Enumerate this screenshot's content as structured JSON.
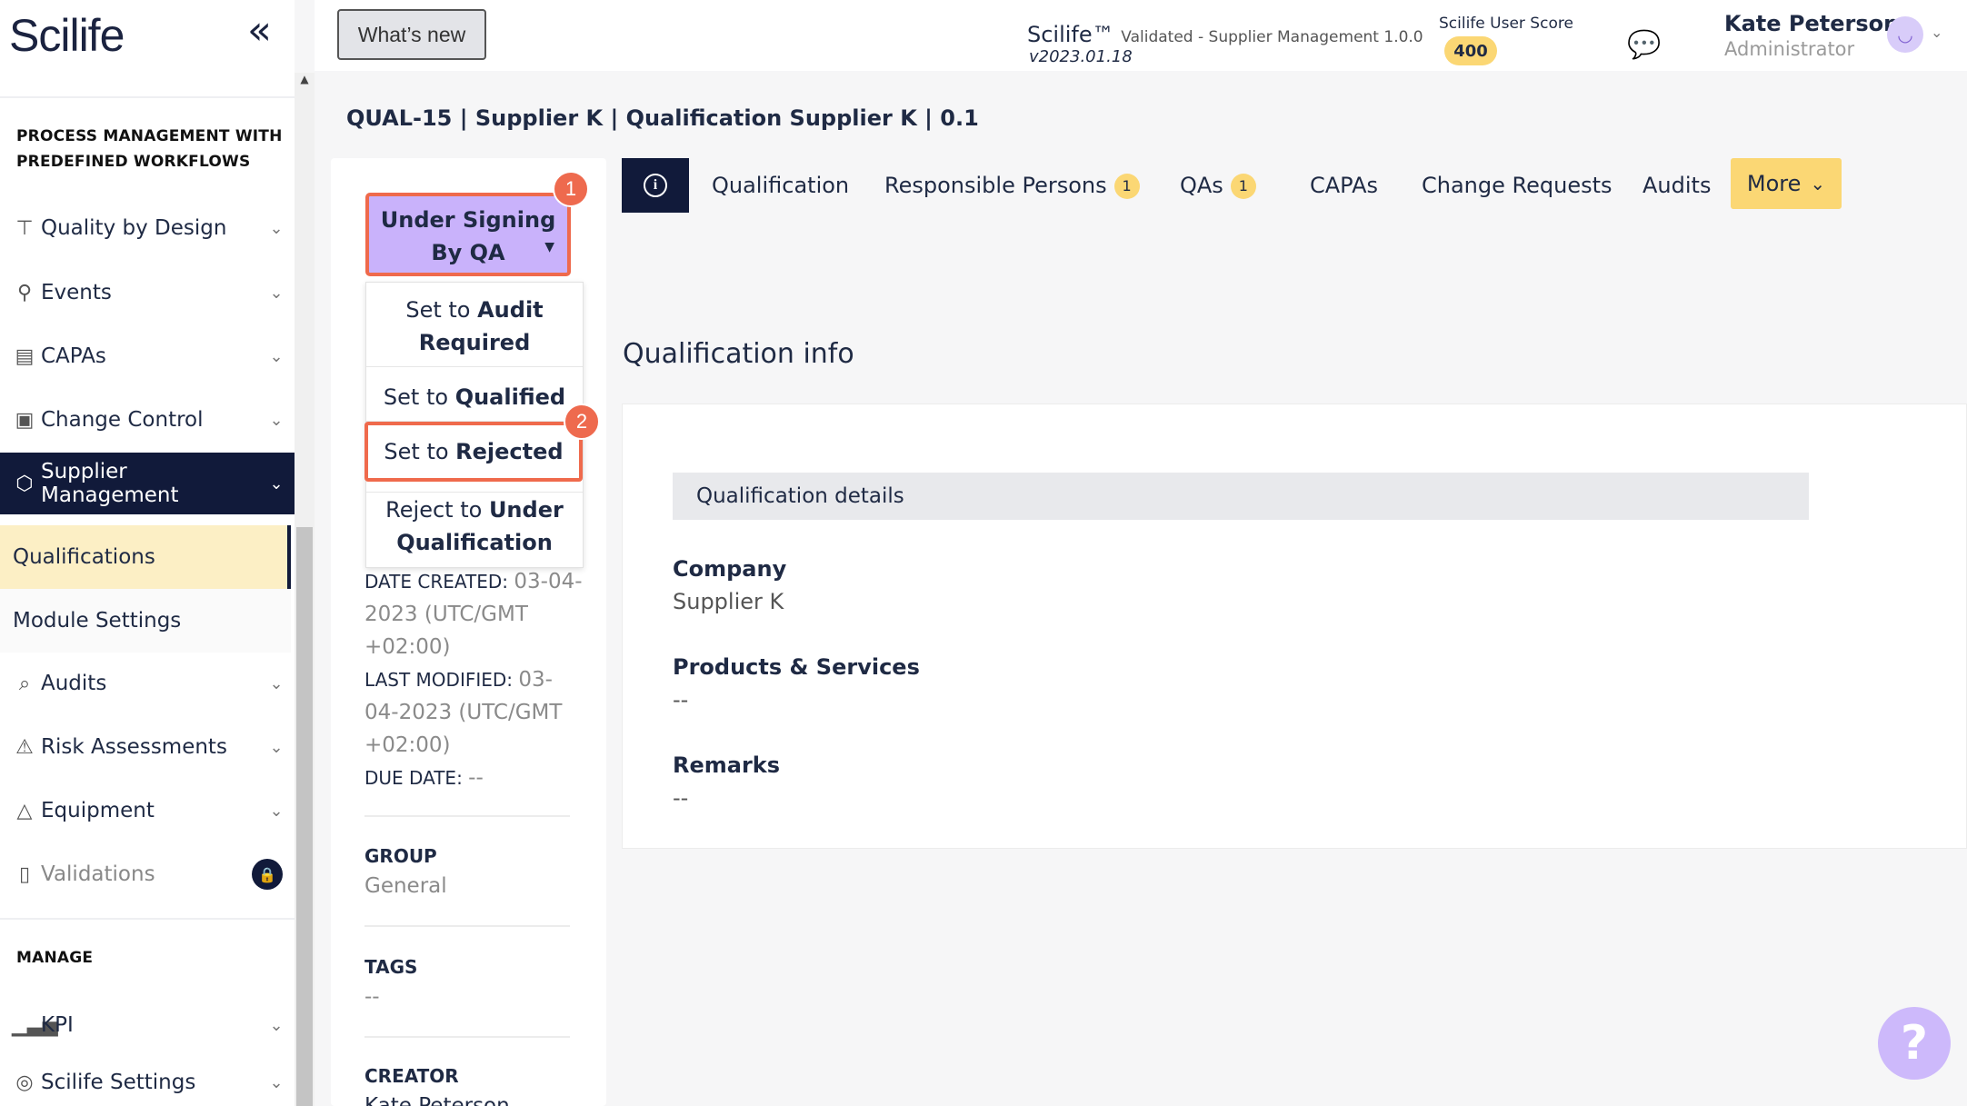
{
  "brand": {
    "logo": "Scilife"
  },
  "sidebar": {
    "section_process": "PROCESS MANAGEMENT WITH PREDEFINED WORKFLOWS",
    "items": [
      {
        "label": "Quality by Design",
        "icon": "signpost-icon"
      },
      {
        "label": "Events",
        "icon": "pin-icon"
      },
      {
        "label": "CAPAs",
        "icon": "chart-icon"
      },
      {
        "label": "Change Control",
        "icon": "document-icon"
      },
      {
        "label": "Supplier Management",
        "icon": "box-icon"
      },
      {
        "label": "Audits",
        "icon": "audit-icon"
      },
      {
        "label": "Risk Assessments",
        "icon": "warning-icon"
      },
      {
        "label": "Equipment",
        "icon": "flask-icon"
      },
      {
        "label": "Validations",
        "icon": "clipboard-icon"
      }
    ],
    "subitems": [
      "Qualifications",
      "Module Settings"
    ],
    "section_manage": "MANAGE",
    "manage_items": [
      {
        "label": "KPI",
        "icon": "bars-icon"
      },
      {
        "label": "Scilife Settings",
        "icon": "settings-icon"
      }
    ],
    "lock_glyph": "🔒"
  },
  "header": {
    "whats_new": "What’s new",
    "app_name": "Scilife™",
    "app_validated": "Validated - Supplier Management 1.0.0",
    "app_version": "v2023.01.18",
    "score_label": "Scilife User Score",
    "score": "400",
    "user_name": "Kate Peterson",
    "user_role": "Administrator"
  },
  "doc": {
    "title": "QUAL-15 | Supplier K | Qualification Supplier K | 0.1",
    "status_line1": "Under Signing",
    "status_line2": "By QA",
    "badge1": "1",
    "badge2": "2",
    "menu": {
      "audit_pre": "Set to ",
      "audit_bold": "Audit Required",
      "qual_pre": "Set to ",
      "qual_bold": "Qualified",
      "rej_pre": "Set to ",
      "rej_bold": "Rejected",
      "under_pre": "Reject to ",
      "under_bold": "Under Qualification"
    },
    "date_created_label": "DATE CREATED: ",
    "date_created_value": "03-04-2023 (UTC/GMT +02:00)",
    "last_modified_label": "LAST MODIFIED: ",
    "last_modified_value": "03-04-2023 (UTC/GMT +02:00)",
    "due_date_label": "DUE DATE: ",
    "due_date_value": "--",
    "group_label": "GROUP",
    "group_value": "General",
    "tags_label": "TAGS",
    "tags_value": "--",
    "creator_label": "CREATOR",
    "creator_value": "Kate Peterson"
  },
  "tabs": {
    "info": "i",
    "qualification": "Qualification",
    "responsible": "Responsible Persons",
    "responsible_count": "1",
    "qas": "QAs",
    "qas_count": "1",
    "capas": "CAPAs",
    "change_requests": "Change Requests",
    "audits": "Audits",
    "more": "More"
  },
  "main": {
    "section_title": "Qualification info",
    "details_header": "Qualification details",
    "company_label": "Company",
    "company_value": "Supplier K",
    "products_label": "Products & Services",
    "products_value": "--",
    "remarks_label": "Remarks",
    "remarks_value": "--"
  },
  "help": "?"
}
